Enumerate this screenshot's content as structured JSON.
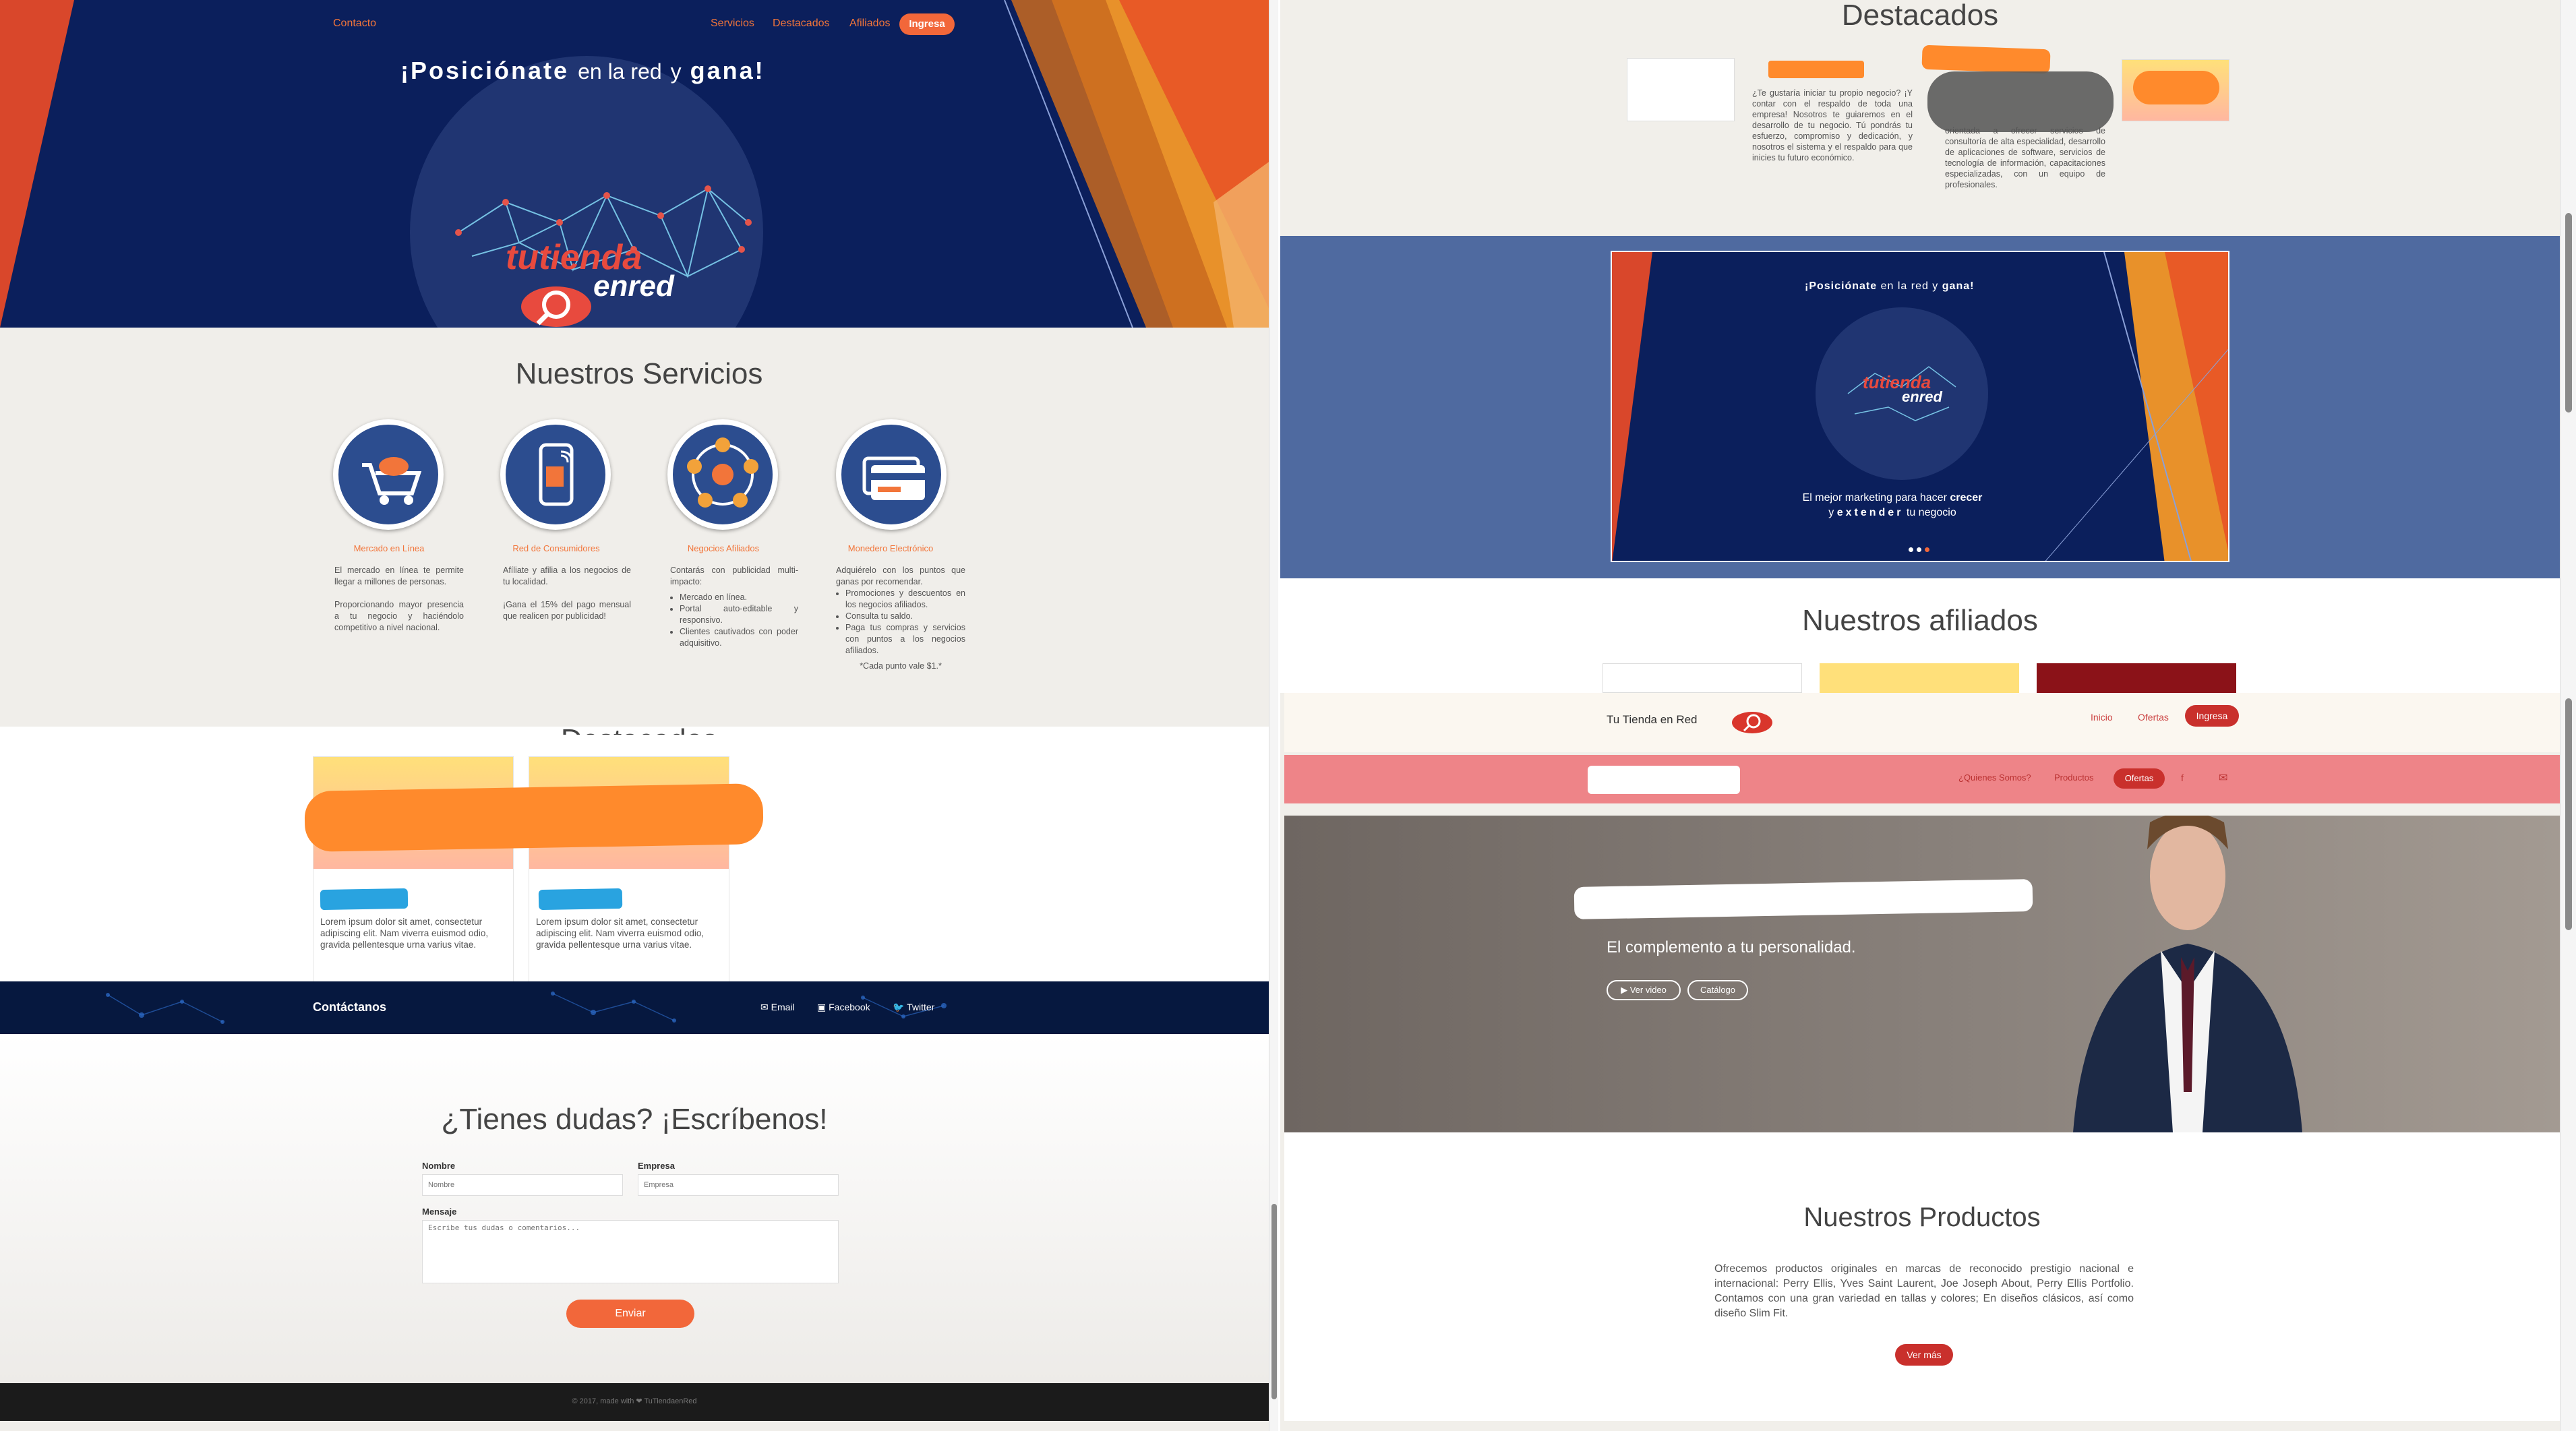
{
  "left": {
    "hero": {
      "contact_link": "Contacto",
      "nav": [
        "Servicios",
        "Destacados",
        "Afiliados"
      ],
      "cta": "Ingresa",
      "title_a": "¡Posiciónate",
      "title_b": "en la red",
      "title_c": "y",
      "title_d": "gana!",
      "logo_line1": "tutienda",
      "logo_line2": "enred"
    },
    "services": {
      "title": "Nuestros Servicios",
      "items": [
        {
          "name": "Mercado en Línea",
          "icon": "shopping-cart-icon",
          "p1": "El mercado en línea te permite llegar a millones de personas.",
          "p2": "Proporcionando mayor presencia a tu negocio y haciéndolo competitivo a nivel nacional."
        },
        {
          "name": "Red de Consumidores",
          "icon": "mobile-phone-icon",
          "p1": "Afíliate y afilia a los negocios de tu localidad.",
          "p2": "¡Gana el 15% del pago mensual que realicen por publicidad!"
        },
        {
          "name": "Negocios Afiliados",
          "icon": "network-globe-icon",
          "p1": "Contarás con publicidad multi-impacto:",
          "bullets": [
            "Mercado en línea.",
            "Portal auto-editable y responsivo.",
            "Clientes cautivados con poder adquisitivo."
          ]
        },
        {
          "name": "Monedero Electrónico",
          "icon": "credit-card-icon",
          "p1": "Adquiérelo con los puntos que ganas por recomendar.",
          "bullets": [
            "Promociones y descuentos en los negocios afiliados.",
            "Consulta tu saldo.",
            "Paga tus compras y servicios con puntos a los negocios afiliados."
          ],
          "note": "*Cada punto vale $1.*"
        }
      ]
    },
    "partial_heading": "Destacados",
    "cards": [
      {
        "text": "Lorem ipsum dolor sit amet, consectetur adipiscing elit. Nam viverra euismod odio, gravida pellentesque urna varius vitae."
      },
      {
        "text": "Lorem ipsum dolor sit amet, consectetur adipiscing elit. Nam viverra euismod odio, gravida pellentesque urna varius vitae."
      }
    ],
    "contact_bar": {
      "title": "Contáctanos",
      "email": "Email",
      "facebook": "Facebook",
      "twitter": "Twitter"
    },
    "form": {
      "title": "¿Tienes dudas? ¡Escríbenos!",
      "name_label": "Nombre",
      "name_placeholder": "Nombre",
      "company_label": "Empresa",
      "company_placeholder": "Empresa",
      "message_label": "Mensaje",
      "message_placeholder": "Escribe tus dudas o comentarios...",
      "submit": "Enviar"
    },
    "footer": "© 2017, made with ❤ TuTiendaenRed"
  },
  "right": {
    "featured": {
      "title": "Destacados",
      "text1": "¿Te gustaría iniciar tu propio negocio? ¡Y contar con el respaldo de toda una empresa! Nosotros te guiaremos en el desarrollo de tu negocio. Tú pondrás tu esfuerzo, compromiso y dedicación, y nosotros el sistema y el respaldo para que inicies tu futuro económico.",
      "text2": "orientada a ofrecer servicios de consultoría de alta especialidad, desarrollo de aplicaciones de software, servicios de tecnología de información, capacitaciones especializadas, con un equipo de profesionales."
    },
    "carousel": {
      "title_a": "¡Posiciónate",
      "title_b": "en la red y",
      "title_c": "gana!",
      "logo_line1": "tutienda",
      "logo_line2": "enred",
      "line1_a": "El mejor marketing para hacer",
      "line1_b": "crecer",
      "line2_a": "y",
      "line2_b": "extender",
      "line2_c": "tu negocio"
    },
    "affiliates_title": "Nuestros afiliados",
    "shop": {
      "brand": "Tu Tienda en Red",
      "nav": [
        "Inicio",
        "Ofertas"
      ],
      "cta": "Ingresa",
      "subnav": [
        "¿Quienes Somos?",
        "Productos"
      ],
      "offers": "Ofertas",
      "tagline": "El complemento a tu personalidad.",
      "video_btn": "▶ Ver video",
      "catalog_btn": "Catálogo",
      "products_title": "Nuestros Productos",
      "products_text": "Ofrecemos productos originales en marcas de reconocido prestigio nacional e internacional: Perry Ellis, Yves Saint Laurent, Joe Joseph About, Perry Ellis Portfolio. Contamos con una gran variedad en tallas y colores; En diseños clásicos, así como diseño Slim Fit.",
      "more_btn": "Ver más"
    }
  },
  "colors": {
    "navy": "#0b1f5c",
    "orange": "#f2673a",
    "red": "#c9302c",
    "pink": "#ee8488"
  }
}
